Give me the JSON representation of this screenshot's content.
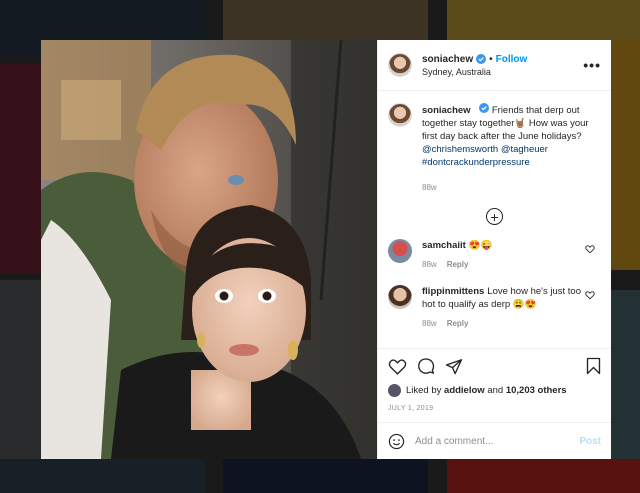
{
  "post": {
    "username": "soniachew",
    "follow_label": "Follow",
    "separator": "•",
    "location": "Sydney, Australia",
    "more_label": "•••",
    "caption_text_1": "Friends that derp out together stay together",
    "caption_emoji": "🤘🏽",
    "caption_text_2": " How was your first day back after the June holidays?",
    "mention_1": "@chrishemsworth",
    "mention_2": "@tagheuer",
    "hashtag": "#dontcrackunderpressure",
    "caption_time": "88w",
    "load_more_label": "+",
    "comments": [
      {
        "username": "samchaiit",
        "text": "😍😜",
        "time": "88w",
        "reply_label": "Reply"
      },
      {
        "username": "flippinmittens",
        "text": "Love how he's just too hot to qualify as derp 😩😍",
        "time": "88w",
        "reply_label": "Reply"
      }
    ],
    "liked_prefix": "Liked by",
    "liked_user": "addielow",
    "liked_and": "and",
    "liked_count": "10,203 others",
    "date": "JULY 1, 2019",
    "comment_placeholder": "Add a comment...",
    "post_button": "Post",
    "carousel": {
      "total": 2,
      "current": 1
    }
  }
}
